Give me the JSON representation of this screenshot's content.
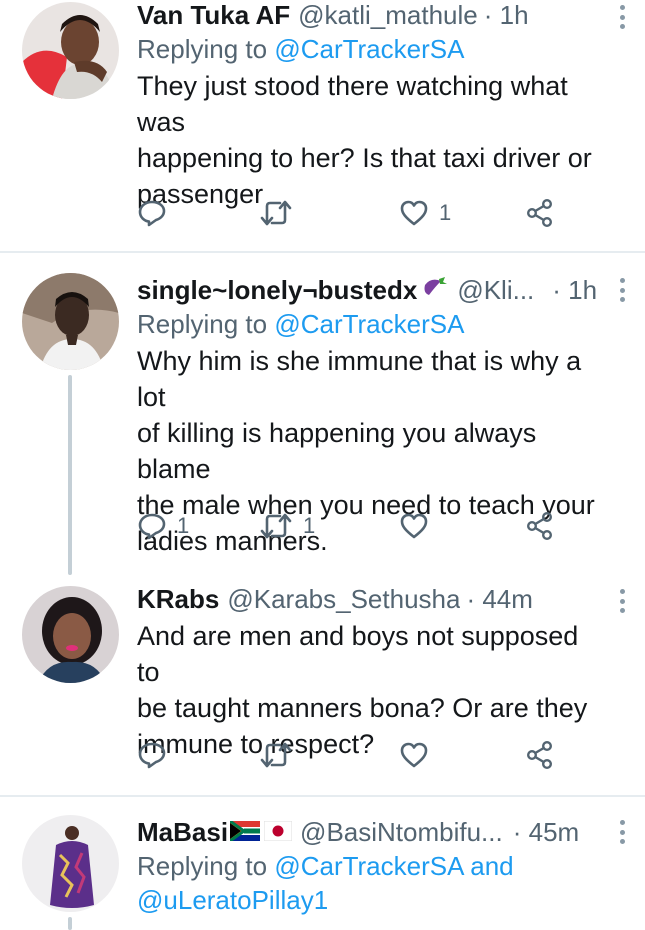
{
  "tweets": [
    {
      "name": "Van Tuka AF",
      "handle": "@katli_mathule",
      "time": "· 1h",
      "replying_prefix": "Replying to ",
      "replying_to": "@CarTrackerSA",
      "text_lines": [
        "They just stood there watching what was",
        "happening to her? Is that taxi driver or",
        "passenger"
      ],
      "reply_count": "",
      "retweet_count": "",
      "like_count": "1"
    },
    {
      "name": "single~lonely¬bustedx",
      "handle": "@Kli...",
      "time": "· 1h",
      "replying_prefix": "Replying to ",
      "replying_to": "@CarTrackerSA",
      "text_lines": [
        "Why him is she immune that is why a lot",
        "of killing is happening you always blame",
        "the male when you need to teach your",
        "ladies manners."
      ],
      "reply_count": "1",
      "retweet_count": "1",
      "like_count": ""
    },
    {
      "name": "KRabs",
      "handle": "@Karabs_Sethusha",
      "time": "· 44m",
      "text_lines": [
        "And are men and boys not supposed to",
        "be taught manners bona? Or are they",
        "immune to respect?"
      ],
      "reply_count": "",
      "retweet_count": "",
      "like_count": ""
    },
    {
      "name": "MaBasi",
      "handle": "@BasiNtombifu...",
      "time": "· 45m",
      "replying_prefix": "Replying to ",
      "replying_to": "@CarTrackerSA",
      "replying_and": " and",
      "replying_to_2": "@uLeratoPillay1"
    }
  ],
  "icons": {
    "reply": "reply-icon",
    "retweet": "retweet-icon",
    "like": "heart-icon",
    "share": "share-icon",
    "more": "more-vertical-icon"
  },
  "colors": {
    "name": "#14171a",
    "secondary": "#536471",
    "mention": "#1d9bf0",
    "divider": "#e6ecf0",
    "thread_line": "#c4cfd6"
  }
}
